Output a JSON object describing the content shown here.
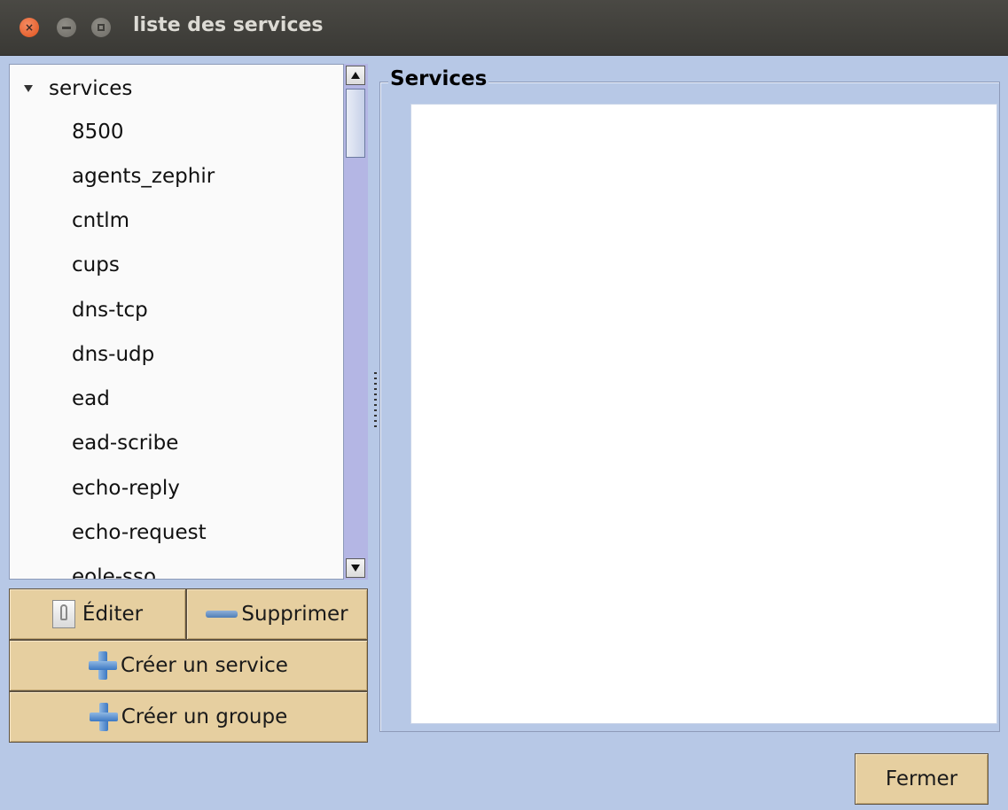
{
  "window": {
    "title": "liste des services",
    "controls": {
      "close_glyph": "×"
    }
  },
  "tree": {
    "root_label": "services",
    "items": [
      "8500",
      "agents_zephir",
      "cntlm",
      "cups",
      "dns-tcp",
      "dns-udp",
      "ead",
      "ead-scribe",
      "echo-reply",
      "echo-request",
      "eole-sso"
    ]
  },
  "buttons": {
    "edit": "Éditer",
    "delete": "Supprimer",
    "create_service": "Créer un service",
    "create_group": "Créer un groupe",
    "close": "Fermer"
  },
  "panel": {
    "title": "Services"
  },
  "colors": {
    "background": "#b7c8e6",
    "button": "#e6cfa0",
    "scrollbar": "#b4b6e4",
    "titlebar": "#3f3e3a"
  },
  "icons": {
    "edit": "document-edit-icon",
    "delete": "minus-icon",
    "create": "plus-icon"
  }
}
